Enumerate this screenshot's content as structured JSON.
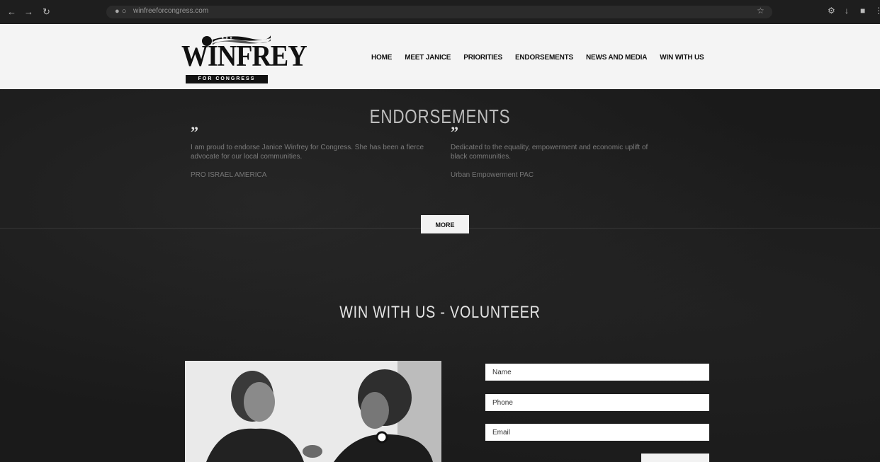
{
  "browser": {
    "url": "winfreeforcongress.com"
  },
  "site": {
    "logo": {
      "word": "WINFREY",
      "tagline": "FOR CONGRESS"
    },
    "nav": [
      "HOME",
      "MEET JANICE",
      "PRIORITIES",
      "ENDORSEMENTS",
      "NEWS AND MEDIA",
      "WIN WITH US"
    ]
  },
  "endorsements": {
    "title": "ENDORSEMENTS",
    "quotes": [
      {
        "mark": "”",
        "text": "I am proud to endorse Janice Winfrey for Congress. She has been a fierce advocate for our local communities.",
        "author": "PRO ISRAEL AMERICA"
      },
      {
        "mark": "”",
        "text": "Dedicated to the equality, empowerment and economic uplift of black communities.",
        "author": "Urban Empowerment PAC"
      }
    ],
    "more_label": "MORE"
  },
  "volunteer": {
    "title": "WIN WITH US - VOLUNTEER",
    "fields": {
      "name": "Name",
      "phone": "Phone",
      "email": "Email"
    }
  },
  "colors": {
    "dark_bg": "#1a1a1a",
    "header_bg": "#f4f4f4",
    "chrome_bg": "#1e1e1e"
  }
}
